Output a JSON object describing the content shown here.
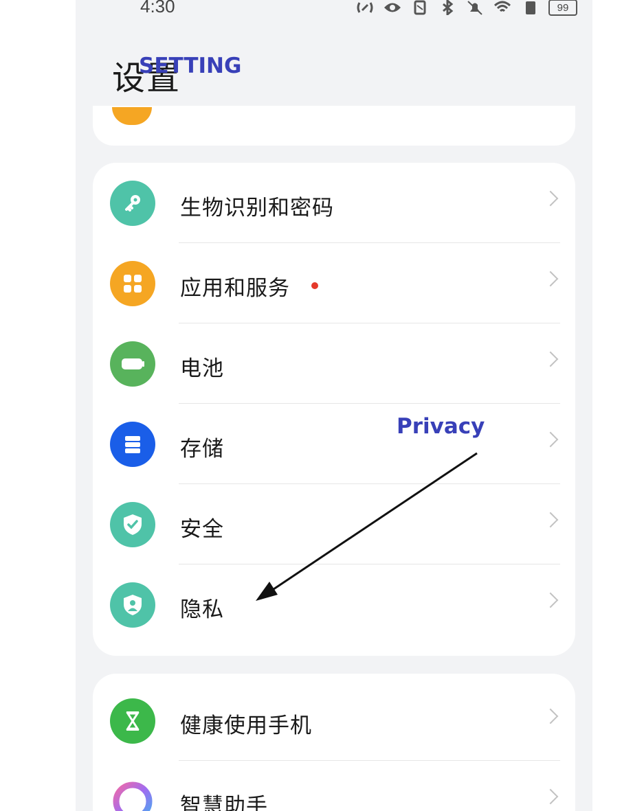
{
  "status_bar": {
    "time": "4:30",
    "battery": "99",
    "icons": [
      "nfc-icon",
      "eye-icon",
      "vibrate-icon",
      "bluetooth-icon",
      "mute-icon",
      "wifi-icon",
      "sim-icon"
    ]
  },
  "header": {
    "title": "设置"
  },
  "annotations": {
    "setting": "SETTING",
    "privacy": "Privacy"
  },
  "menu_group_1": [
    {
      "label": "生物识别和密码",
      "icon": "key-icon",
      "color": "#4fc3a8",
      "badge": false
    },
    {
      "label": "应用和服务",
      "icon": "apps-icon",
      "color": "#f5a623",
      "badge": true
    },
    {
      "label": "电池",
      "icon": "battery-icon",
      "color": "#58b35c",
      "badge": false
    },
    {
      "label": "存储",
      "icon": "storage-icon",
      "color": "#1a5ee8",
      "badge": false
    },
    {
      "label": "安全",
      "icon": "shield-check-icon",
      "color": "#4fc3a8",
      "badge": false
    },
    {
      "label": "隐私",
      "icon": "privacy-icon",
      "color": "#4fc3a8",
      "badge": false
    }
  ],
  "menu_group_2": [
    {
      "label": "健康使用手机",
      "icon": "hourglass-icon",
      "color": "#3cb84a"
    },
    {
      "label": "智慧助手",
      "icon": "assistant-icon",
      "color": "#a06cf0"
    }
  ],
  "colors": {
    "annotation": "#3840b8",
    "badge": "#e5392b",
    "background": "#f2f3f5"
  }
}
